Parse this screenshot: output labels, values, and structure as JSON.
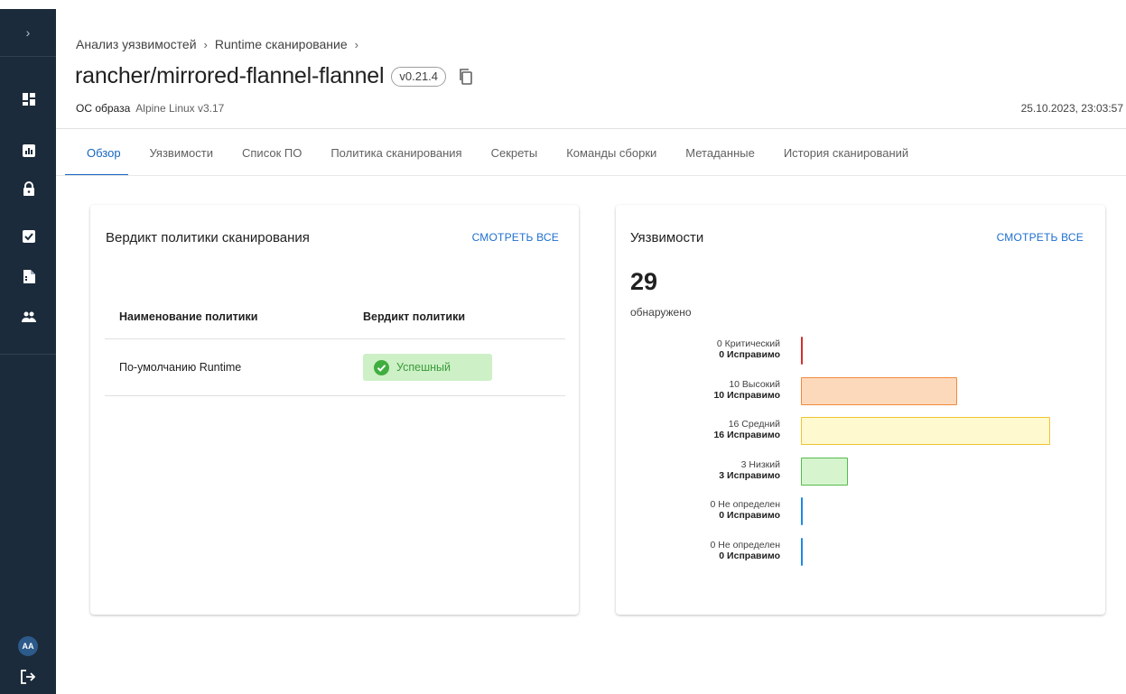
{
  "sidebar": {
    "expand_glyph": "›",
    "icons": [
      "dashboard-icon",
      "chart-icon",
      "lock-icon",
      "checkbox-icon",
      "document-icon",
      "users-icon"
    ],
    "avatar_initials": "AA",
    "logout_icon": "logout-icon"
  },
  "header": {
    "breadcrumb": [
      "Анализ уязвимостей",
      "Runtime сканирование"
    ],
    "breadcrumb_separator": "›",
    "title": "rancher/mirrored-flannel-flannel",
    "version": "v0.21.4",
    "os_label": "ОС образа",
    "os_value": "Alpine Linux v3.17",
    "timestamp": "25.10.2023, 23:03:57"
  },
  "tabs": [
    {
      "label": "Обзор",
      "active": true
    },
    {
      "label": "Уязвимости",
      "active": false
    },
    {
      "label": "Список ПО",
      "active": false
    },
    {
      "label": "Политика сканирования",
      "active": false
    },
    {
      "label": "Секреты",
      "active": false
    },
    {
      "label": "Команды сборки",
      "active": false
    },
    {
      "label": "Метаданные",
      "active": false
    },
    {
      "label": "История сканирований",
      "active": false
    }
  ],
  "policy_card": {
    "title": "Вердикт политики сканирования",
    "view_all": "СМОТРЕТЬ ВСЕ",
    "columns": [
      "Наименование политики",
      "Вердикт политики"
    ],
    "rows": [
      {
        "name": "По-умолчанию Runtime",
        "verdict": "Успешный",
        "status_color": "#3fae3f"
      }
    ]
  },
  "vuln_card": {
    "title": "Уязвимости",
    "view_all": "СМОТРЕТЬ ВСЕ",
    "total": "29",
    "total_label": "обнаружено",
    "severities": [
      {
        "label": "0 Критический",
        "fixable": "0 Исправимо",
        "count": 0,
        "fill": "#ffffff",
        "border": "#d32f2f"
      },
      {
        "label": "10 Высокий",
        "fixable": "10 Исправимо",
        "count": 10,
        "fill": "#fdd9bc",
        "border": "#f08a3c"
      },
      {
        "label": "16 Средний",
        "fixable": "16 Исправимо",
        "count": 16,
        "fill": "#fff9cf",
        "border": "#f0c232"
      },
      {
        "label": "3 Низкий",
        "fixable": "3 Исправимо",
        "count": 3,
        "fill": "#d6f5cf",
        "border": "#56b94c"
      },
      {
        "label": "0 Не определен",
        "fixable": "0 Исправимо",
        "count": 0,
        "fill": "#ffffff",
        "border": "#1e88e5"
      },
      {
        "label": "0 Не определен",
        "fixable": "0 Исправимо",
        "count": 0,
        "fill": "#ffffff",
        "border": "#1e88e5"
      }
    ],
    "max_count": 16
  }
}
